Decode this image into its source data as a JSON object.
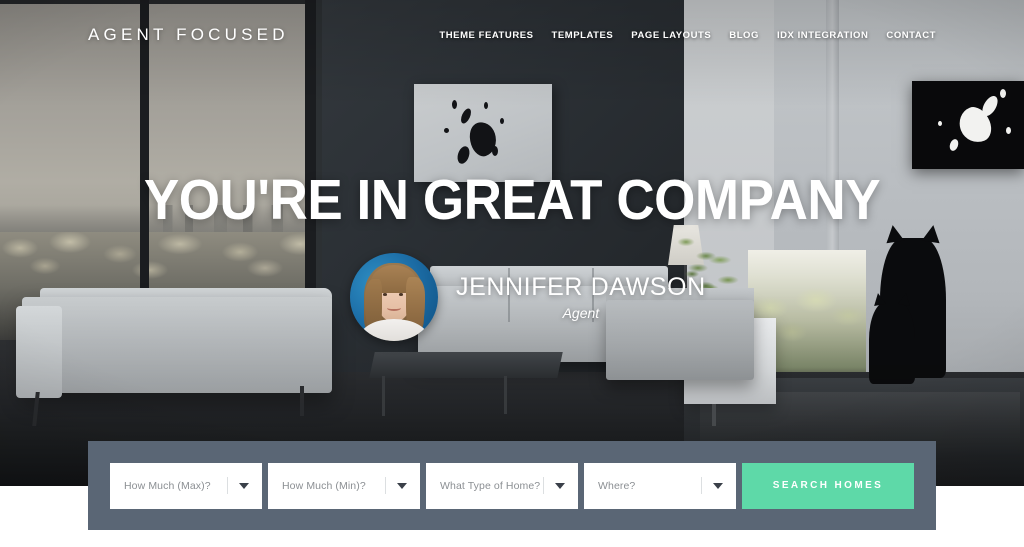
{
  "header": {
    "logo": "AGENT FOCUSED",
    "nav": [
      {
        "label": "THEME FEATURES"
      },
      {
        "label": "TEMPLATES"
      },
      {
        "label": "PAGE LAYOUTS"
      },
      {
        "label": "BLOG"
      },
      {
        "label": "IDX INTEGRATION"
      },
      {
        "label": "CONTACT"
      }
    ]
  },
  "hero": {
    "title": "YOU'RE IN GREAT COMPANY",
    "agent": {
      "name": "JENNIFER DAWSON",
      "role": "Agent",
      "avatar_icon": "agent-portrait-avatar"
    }
  },
  "search": {
    "fields": [
      {
        "label": "How Much (Max)?",
        "caret_icon": "chevron-down-icon"
      },
      {
        "label": "How Much (Min)?",
        "caret_icon": "chevron-down-icon"
      },
      {
        "label": "What Type of Home?",
        "caret_icon": "chevron-down-icon"
      },
      {
        "label": "Where?",
        "caret_icon": "chevron-down-icon"
      }
    ],
    "submit_label": "SEARCH HOMES"
  },
  "colors": {
    "accent_green": "#5ed9a8",
    "panel_slate": "#5a6675",
    "text_white": "#ffffff",
    "field_text": "#8b8f93"
  }
}
